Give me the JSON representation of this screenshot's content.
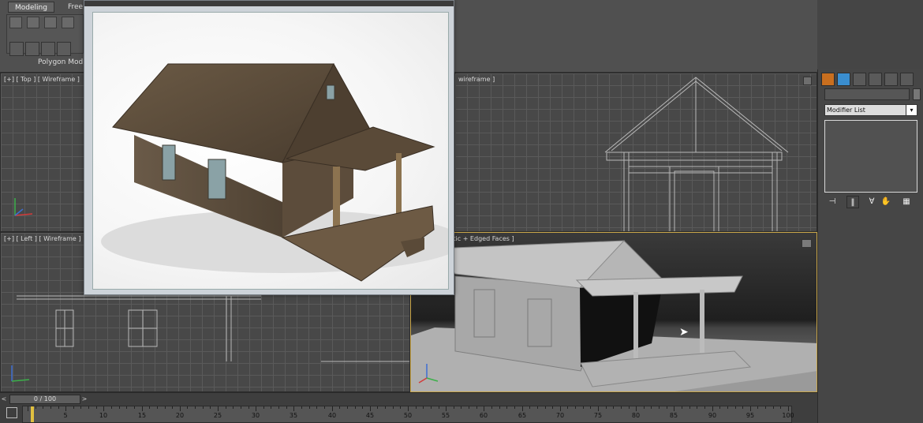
{
  "ribbon": {
    "tabs": [
      "Modeling",
      "Free"
    ],
    "active_tab": "Modeling",
    "panel_label": "Polygon Modi"
  },
  "viewports": {
    "top": {
      "label": "[+] [ Top ] [ Wireframe ]"
    },
    "front": {
      "label": "wireframe ]"
    },
    "left": {
      "label": "[+] [ Left ] [ Wireframe ]"
    },
    "perspective": {
      "label": "ive ] [ Realistic + Edged Faces ]"
    }
  },
  "command_panel": {
    "tab_icons": [
      "create-icon",
      "modify-icon",
      "hierarchy-icon",
      "motion-icon",
      "display-icon",
      "utilities-icon"
    ],
    "modifier_list_label": "Modifier List",
    "stack_buttons": [
      "pin-stack-icon",
      "show-end-result-icon",
      "make-unique-icon",
      "remove-modifier-icon",
      "configure-modifier-sets-icon"
    ]
  },
  "timeline": {
    "slider_value": "0 / 100",
    "slider_prev": "<",
    "slider_next": ">",
    "ruler_labels": [
      "5",
      "10",
      "15",
      "20",
      "25",
      "30",
      "35",
      "40",
      "45",
      "50",
      "55",
      "60",
      "65",
      "70",
      "75",
      "80",
      "85",
      "90",
      "95",
      "100"
    ]
  },
  "render_window": {
    "title": "",
    "background_color": "#ffffff"
  },
  "colors": {
    "active_viewport_border": "#c9a64a",
    "ui_background": "#454545"
  }
}
